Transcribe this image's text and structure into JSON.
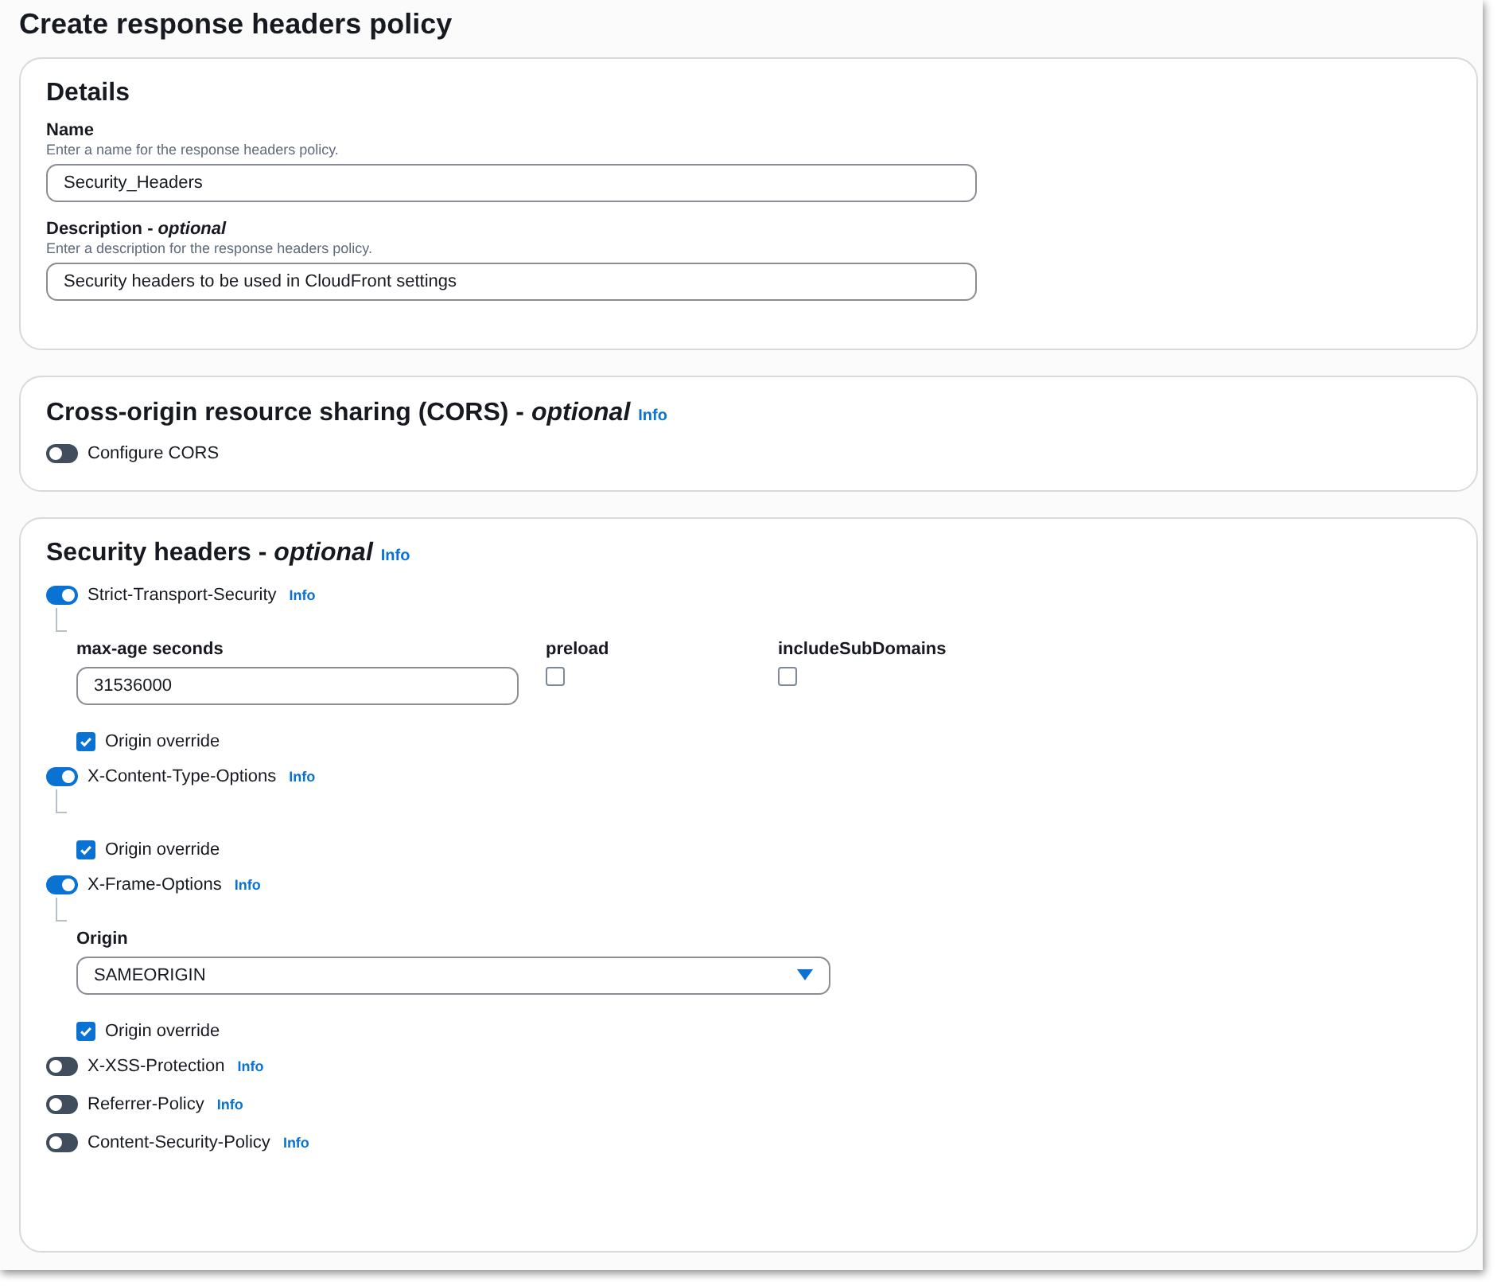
{
  "title": "Create response headers policy",
  "details": {
    "heading": "Details",
    "fields": [
      {
        "label": "Name",
        "hint": "Enter a name for the response headers policy.",
        "value": "Security_Headers"
      },
      {
        "label": "Description - *optional*",
        "hint": "Enter a description for the response headers policy.",
        "value": "Security headers to be used in CloudFront settings"
      }
    ]
  },
  "cors": {
    "heading": "Cross-origin resource sharing (CORS) - *optional*",
    "info": "Info",
    "toggle": {
      "label": "Configure CORS",
      "on": false
    }
  },
  "security": {
    "heading": "Security headers - *optional*",
    "info": "Info",
    "headers": [
      {
        "label": "Strict-Transport-Security",
        "info": "Info",
        "on": true,
        "fields": [
          {
            "kind": "input",
            "label": "max-age seconds",
            "value": "31536000"
          },
          {
            "kind": "check",
            "label": "preload",
            "checked": false
          },
          {
            "kind": "check",
            "label": "includeSubDomains",
            "checked": false
          }
        ],
        "override": {
          "label": "Origin override",
          "checked": true
        }
      },
      {
        "label": "X-Content-Type-Options",
        "info": "Info",
        "on": true,
        "override": {
          "label": "Origin override",
          "checked": true
        }
      },
      {
        "label": "X-Frame-Options",
        "info": "Info",
        "on": true,
        "fields": [
          {
            "kind": "select",
            "label": "Origin",
            "value": "SAMEORIGIN"
          }
        ],
        "override": {
          "label": "Origin override",
          "checked": true
        }
      },
      {
        "label": "X-XSS-Protection",
        "info": "Info",
        "on": false
      },
      {
        "label": "Referrer-Policy",
        "info": "Info",
        "on": false
      },
      {
        "label": "Content-Security-Policy",
        "info": "Info",
        "on": false
      }
    ]
  }
}
